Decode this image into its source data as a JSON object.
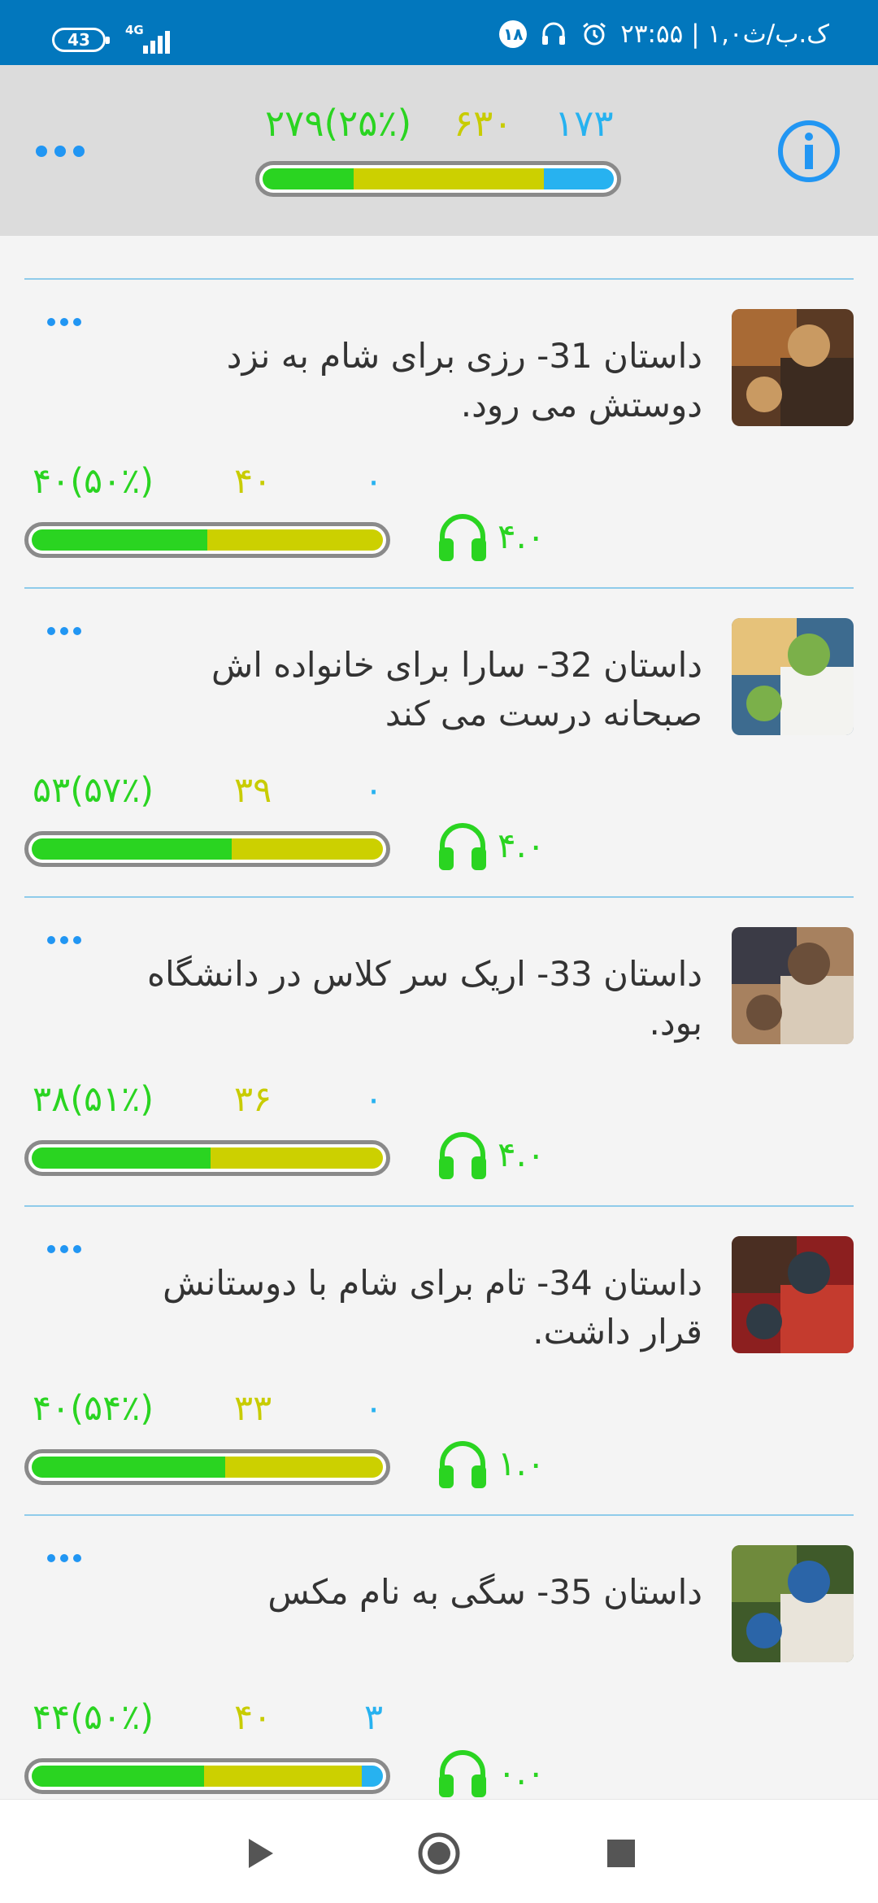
{
  "status_bar": {
    "battery": "43",
    "network": "4G",
    "time_text": "۲۳:۵۵ | ۱,۰ک.ب/ث",
    "notification_count": "۱۸"
  },
  "header": {
    "counts": {
      "known": "۲۷۹(۲۵٪)",
      "learning": "۶۳۰",
      "new": "۱۷۳"
    },
    "progress": {
      "green": 0.26,
      "yellow": 0.54,
      "blue": 0.2
    }
  },
  "stories": [
    {
      "title": "داستان 31- رزی برای شام به نزد دوستش می رود.",
      "counts": {
        "known": "۴۰(۵۰٪)",
        "learning": "۴۰",
        "new": "۰"
      },
      "progress": {
        "green": 0.5,
        "yellow": 0.5,
        "blue": 0
      },
      "rating": "۴.۰",
      "thumb_colors": [
        "#5a3a24",
        "#a86a35",
        "#3c2b20",
        "#c99a62"
      ]
    },
    {
      "title": "داستان 32- سارا برای خانواده اش صبحانه درست می کند",
      "counts": {
        "known": "۵۳(۵۷٪)",
        "learning": "۳۹",
        "new": "۰"
      },
      "progress": {
        "green": 0.57,
        "yellow": 0.43,
        "blue": 0
      },
      "rating": "۴.۰",
      "thumb_colors": [
        "#3d6b8f",
        "#e6c27a",
        "#f3f3f0",
        "#7bb04a"
      ]
    },
    {
      "title": "داستان 33- اریک سر کلاس در دانشگاه بود.",
      "counts": {
        "known": "۳۸(۵۱٪)",
        "learning": "۳۶",
        "new": "۰"
      },
      "progress": {
        "green": 0.51,
        "yellow": 0.49,
        "blue": 0
      },
      "rating": "۴.۰",
      "thumb_colors": [
        "#a7815f",
        "#3b3b46",
        "#d9cbb8",
        "#6b4f3a"
      ]
    },
    {
      "title": "داستان 34- تام برای شام با دوستانش قرار داشت.",
      "counts": {
        "known": "۴۰(۵۴٪)",
        "learning": "۳۳",
        "new": "۰"
      },
      "progress": {
        "green": 0.55,
        "yellow": 0.45,
        "blue": 0
      },
      "rating": "۱.۰",
      "thumb_colors": [
        "#8c1f1f",
        "#4a2e22",
        "#c43b2e",
        "#2f3b45"
      ]
    },
    {
      "title": "داستان 35- سگی به نام مکس",
      "counts": {
        "known": "۴۴(۵۰٪)",
        "learning": "۴۰",
        "new": "۳"
      },
      "progress": {
        "green": 0.49,
        "yellow": 0.45,
        "blue": 0.06
      },
      "rating": "۰.۰",
      "thumb_colors": [
        "#3f5a2a",
        "#6f8a3c",
        "#e9e4da",
        "#2b65a8"
      ]
    }
  ],
  "colors": {
    "status_bar": "#0277bd",
    "accent": "#2196f3",
    "green": "#2ad421",
    "yellow": "#c8cc00",
    "blue": "#27b2f0"
  },
  "icons": {
    "header_left": "more-dots-icon",
    "header_right": "info-icon",
    "rating": "headphones-icon",
    "nav": [
      "back-icon",
      "home-icon",
      "recents-icon"
    ]
  }
}
